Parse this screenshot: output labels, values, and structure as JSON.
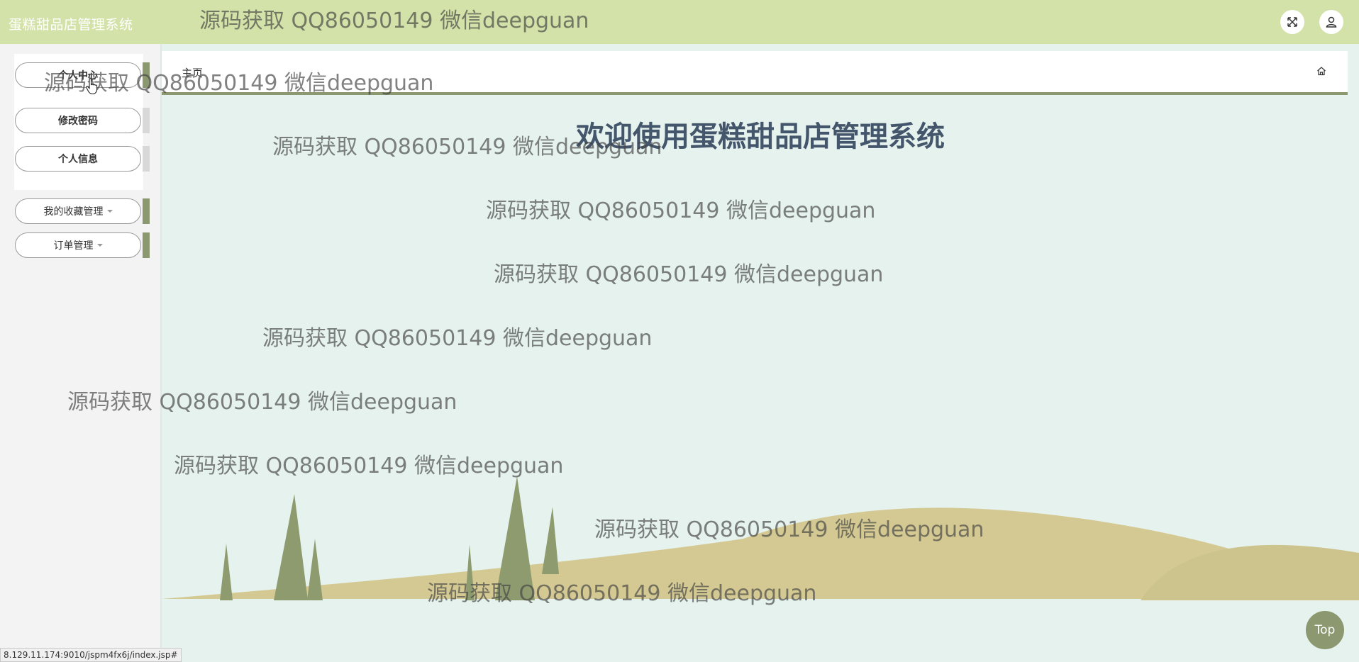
{
  "header": {
    "title": "蛋糕甜品店管理系统",
    "fullscreen_icon": "fullscreen-icon",
    "user_icon": "user-icon"
  },
  "sidebar": {
    "items": [
      {
        "label": "个人中心"
      },
      {
        "label": "修改密码"
      },
      {
        "label": "个人信息"
      },
      {
        "label": "我的收藏管理"
      },
      {
        "label": "订单管理"
      }
    ]
  },
  "tabs": {
    "home_label": "主页",
    "home_icon": "home-icon"
  },
  "main": {
    "welcome": "欢迎使用蛋糕甜品店管理系统"
  },
  "watermark": {
    "text": "源码获取 QQ86050149 微信deepguan"
  },
  "footer": {
    "top_label": "Top",
    "status_url": "8.129.11.174:9010/jspm4fx6j/index.jsp#"
  },
  "colors": {
    "topbar": "#d3e2a8",
    "accent": "#8c9870",
    "background": "#e6f2ee",
    "welcome_text": "#44566b"
  }
}
